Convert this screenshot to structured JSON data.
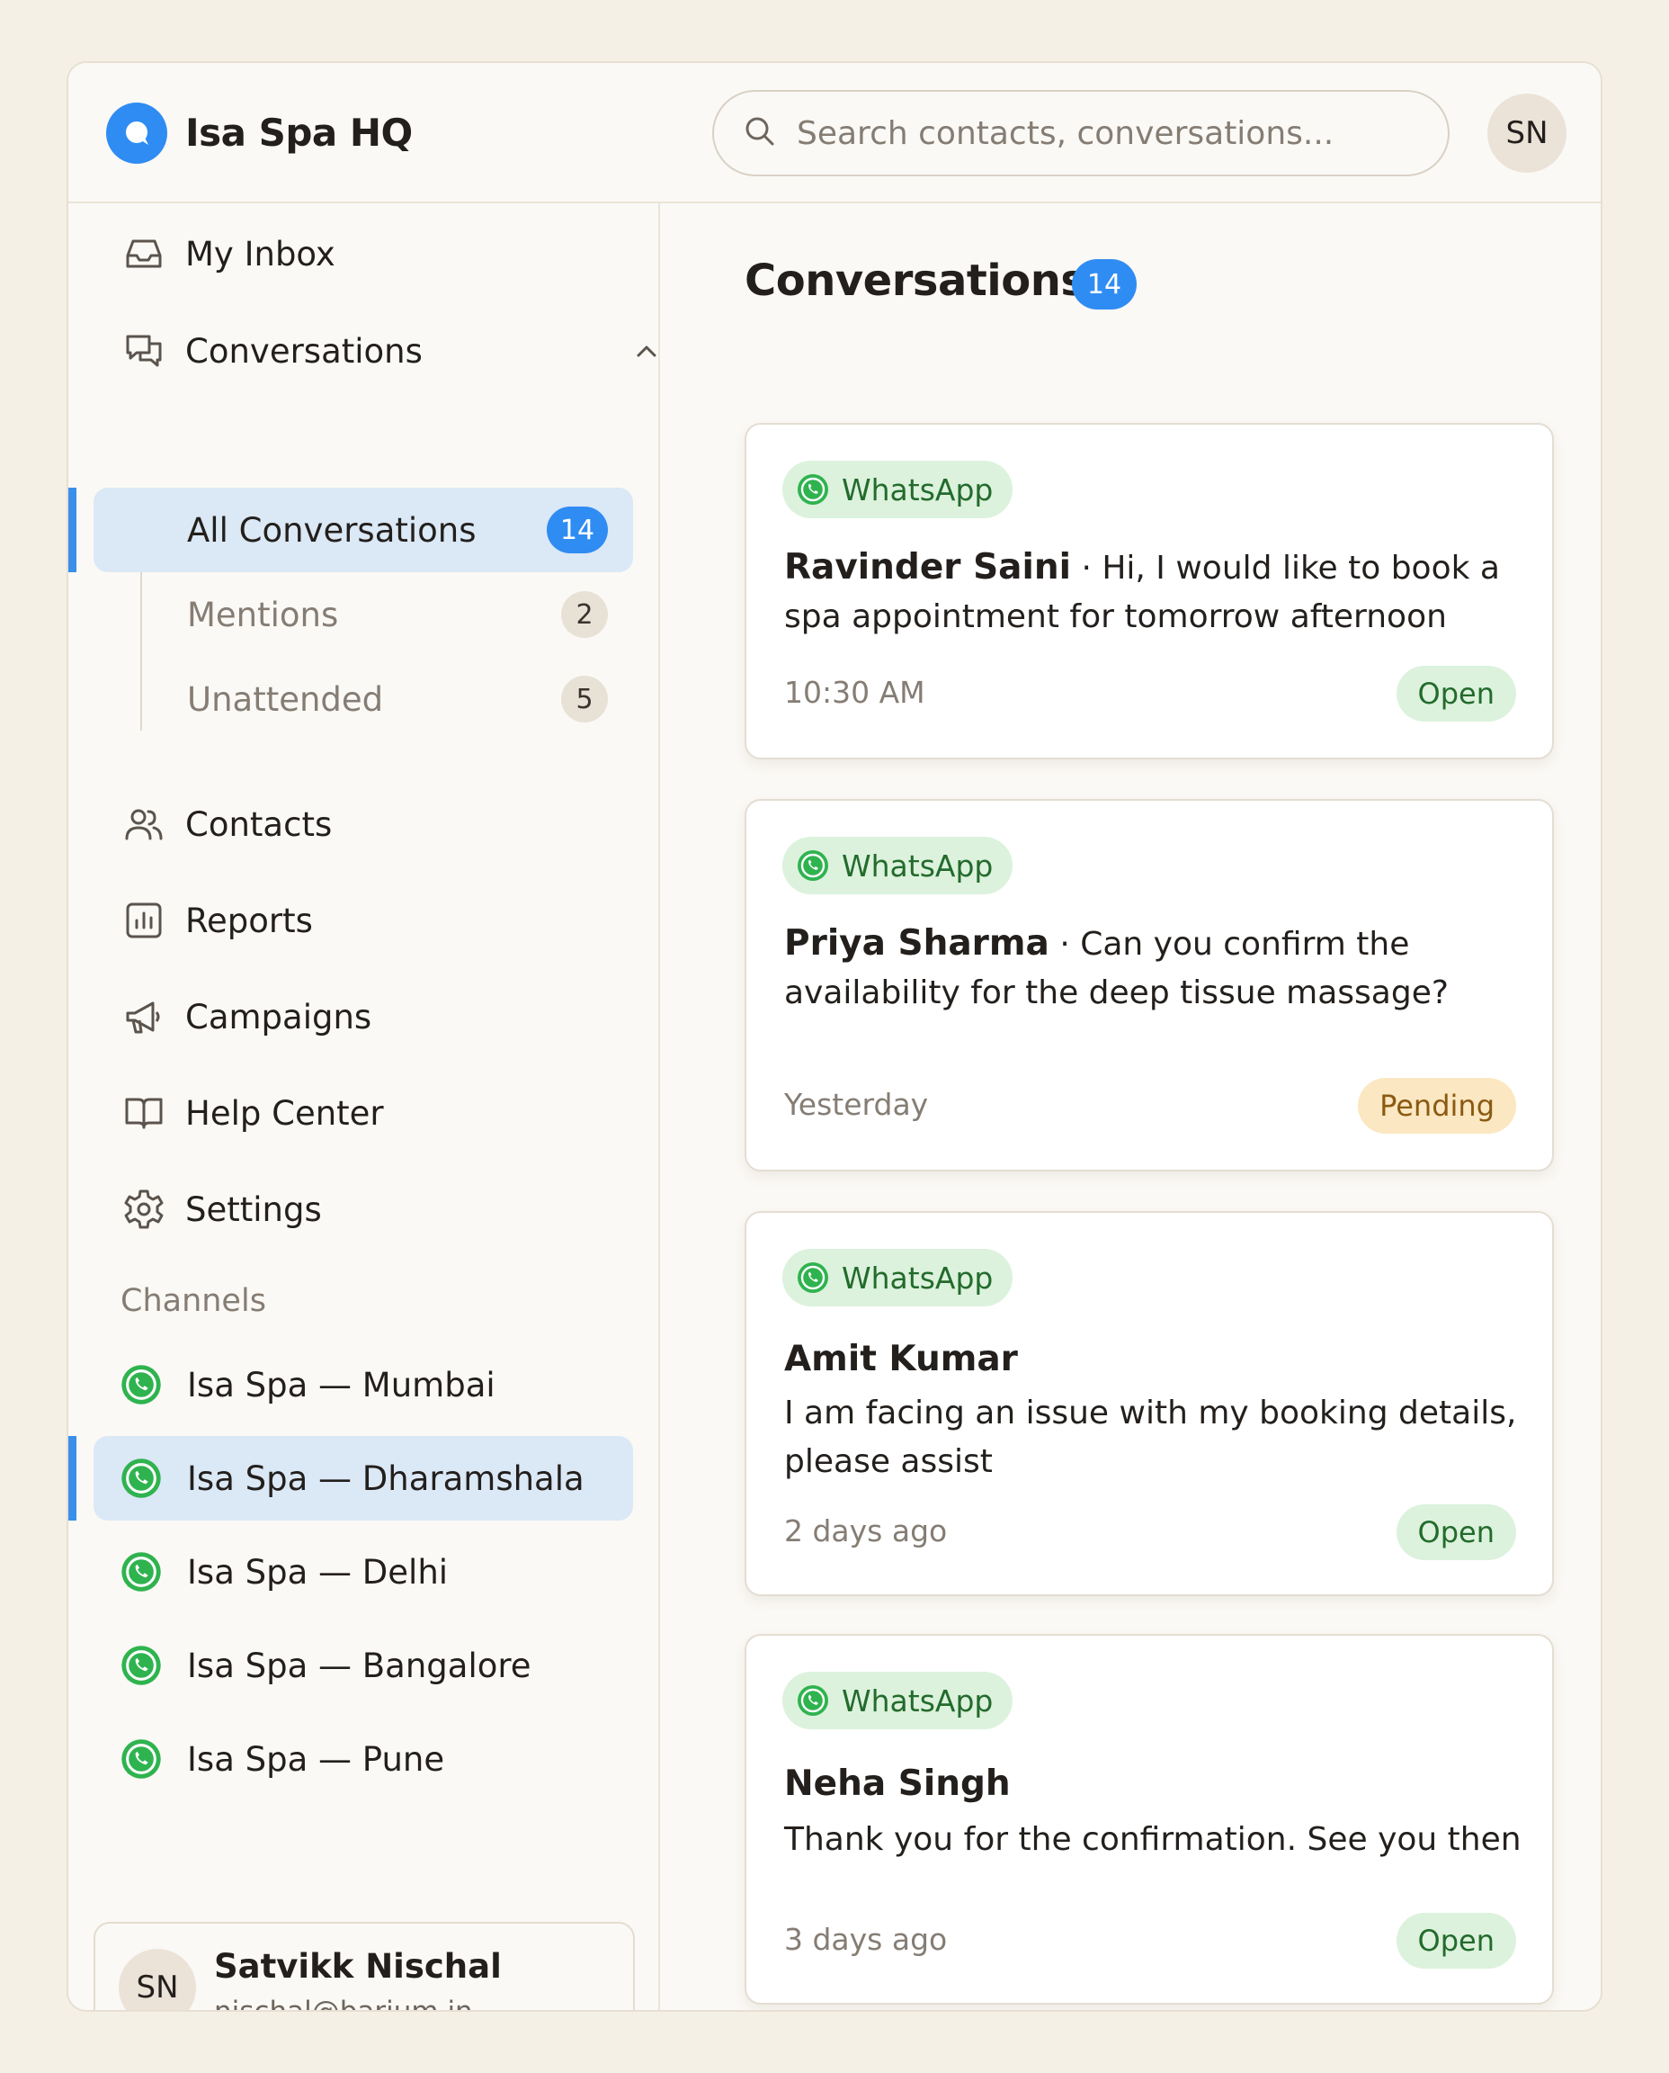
{
  "header": {
    "app_title": "Isa Spa HQ",
    "search_placeholder": "Search contacts, conversations...",
    "avatar_initials": "SN"
  },
  "sidebar": {
    "nav": [
      {
        "label": "My Inbox",
        "icon": "inbox-icon"
      },
      {
        "label": "Conversations",
        "icon": "chat-bubbles-icon"
      },
      {
        "label": "Contacts",
        "icon": "users-icon"
      },
      {
        "label": "Reports",
        "icon": "bar-chart-icon"
      },
      {
        "label": "Campaigns",
        "icon": "megaphone-icon"
      },
      {
        "label": "Help Center",
        "icon": "book-icon"
      },
      {
        "label": "Settings",
        "icon": "gear-icon"
      }
    ],
    "conversation_sub": [
      {
        "label": "All Conversations",
        "count": "14",
        "active": true
      },
      {
        "label": "Mentions",
        "count": "2",
        "active": false
      },
      {
        "label": "Unattended",
        "count": "5",
        "active": false
      }
    ],
    "channels_label": "Channels",
    "channels": [
      {
        "label": "Isa Spa — Mumbai",
        "active": false
      },
      {
        "label": "Isa Spa — Dharamshala",
        "active": true
      },
      {
        "label": "Isa Spa — Delhi",
        "active": false
      },
      {
        "label": "Isa Spa — Bangalore",
        "active": false
      },
      {
        "label": "Isa Spa — Pune",
        "active": false
      }
    ],
    "user": {
      "initials": "SN",
      "name": "Satvikk Nischal",
      "email": "nischal@barium.in"
    }
  },
  "main": {
    "title": "Conversations",
    "count": "14",
    "cards": [
      {
        "channel": "WhatsApp",
        "name": "Ravinder Saini",
        "separator": " · ",
        "message": "Hi, I would like to book a spa appointment for tomorrow afternoon",
        "time": "10:30 AM",
        "status": "Open"
      },
      {
        "channel": "WhatsApp",
        "name": "Priya Sharma",
        "separator": " · ",
        "message": "Can you confirm the availability for the deep tissue massage?",
        "time": "Yesterday",
        "status": "Pending"
      },
      {
        "channel": "WhatsApp",
        "name": "Amit Kumar",
        "separator": "",
        "message": "I am facing an issue with my booking details, please assist",
        "time": "2 days ago",
        "status": "Open"
      },
      {
        "channel": "WhatsApp",
        "name": "Neha Singh",
        "separator": "",
        "message": "Thank you for the confirmation. See you then",
        "time": "3 days ago",
        "status": "Open"
      }
    ]
  },
  "colors": {
    "accent": "#2f8cf3",
    "whatsapp": "#25b14a",
    "open_bg": "#dcf2dd",
    "pending_bg": "#fbe7c1"
  }
}
